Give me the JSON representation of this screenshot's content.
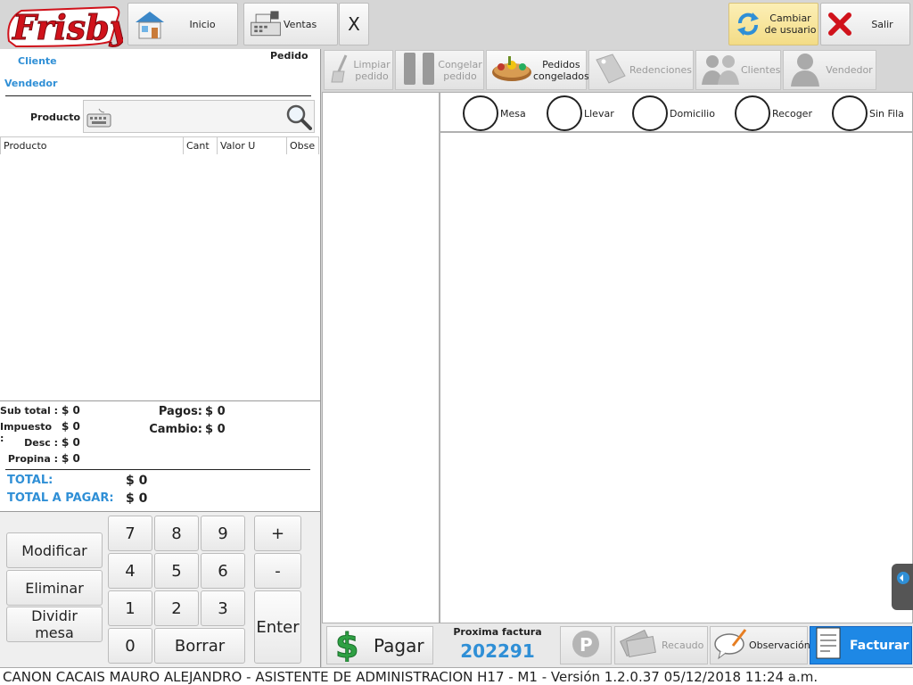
{
  "brand": {
    "logo_text": "Frisby"
  },
  "topbar": {
    "inicio": "Inicio",
    "ventas": "Ventas",
    "close": "X",
    "cambiar_usuario": "Cambiar de usuario",
    "salir": "Salir"
  },
  "order": {
    "cliente_label": "Cliente",
    "pedido_label": "Pedido",
    "vendedor_label": "Vendedor",
    "producto_label": "Producto",
    "producto_value": "",
    "columns": [
      "Producto",
      "Cant",
      "Valor U",
      "Obse"
    ]
  },
  "totals": {
    "subtotal_label": "Sub total :",
    "subtotal": "$ 0",
    "impuesto_label": "Impuesto :",
    "impuesto": "$ 0",
    "desc_label": "Desc :",
    "desc": "$ 0",
    "propina_label": "Propina :",
    "propina": "$ 0",
    "pagos_label": "Pagos:",
    "pagos": "$ 0",
    "cambio_label": "Cambio:",
    "cambio": "$ 0",
    "total_label": "TOTAL:",
    "total": "$ 0",
    "total_pagar_label": "TOTAL A PAGAR:",
    "total_pagar": "$ 0"
  },
  "keypad": {
    "modificar": "Modificar",
    "eliminar": "Eliminar",
    "dividir_1": "Dividir",
    "dividir_2": "mesa",
    "k7": "7",
    "k8": "8",
    "k9": "9",
    "k4": "4",
    "k5": "5",
    "k6": "6",
    "k1": "1",
    "k2": "2",
    "k3": "3",
    "k0": "0",
    "borrar": "Borrar",
    "plus": "+",
    "minus": "-",
    "enter": "Enter"
  },
  "toolbar": {
    "limpiar_1": "Limpiar",
    "limpiar_2": "pedido",
    "congelar_1": "Congelar",
    "congelar_2": "pedido",
    "pedidos_1": "Pedidos",
    "pedidos_2": "congelados",
    "redenciones": "Redenciones",
    "clientes": "Clientes",
    "vendedor": "Vendedor"
  },
  "order_type": {
    "mesa": "Mesa",
    "llevar": "Llevar",
    "domicilio": "Domicilio",
    "recoger": "Recoger",
    "sin_fila": "Sin Fila"
  },
  "bottom": {
    "pagar": "Pagar",
    "proxima_label": "Proxima factura",
    "proxima_value": "202291",
    "recaudo": "Recaudo",
    "observacion": "Observación",
    "facturar": "Facturar"
  },
  "status": {
    "text": "CANON CACAIS MAURO ALEJANDRO - ASISTENTE DE ADMINISTRACION H17 - M1  -  Versión 1.2.0.37 05/12/2018 11:24 a.m."
  },
  "colors": {
    "accent_blue": "#2f8fd6",
    "brand_red": "#d0121b",
    "facturar_blue": "#1e88e5",
    "cambiar_yellow": "#f8e59a"
  }
}
